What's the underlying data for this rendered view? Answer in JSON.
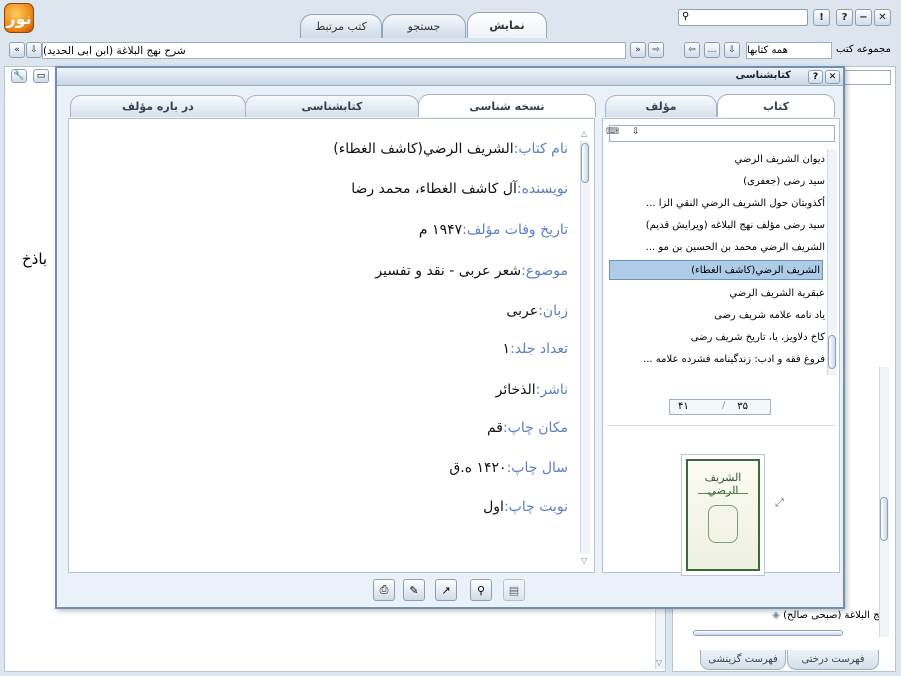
{
  "app": {
    "logo_text": "نور"
  },
  "top_tabs": [
    {
      "label": "نمایش",
      "active": true
    },
    {
      "label": "جستجو",
      "active": false
    },
    {
      "label": "کتب مرتبط",
      "active": false
    }
  ],
  "window_buttons": {
    "close": "✕",
    "minimize": "−",
    "help": "?",
    "info": "!"
  },
  "path": {
    "text": "شرح نهج البلاغة (ابن ابی الحدید)"
  },
  "collection": {
    "label": "مجموعه کتب",
    "value": "همه کتابها"
  },
  "background": {
    "book_word": "باذخ"
  },
  "right_tree": {
    "visible_item": "نهج البلاغة (صبحی صالح)",
    "bottom_tabs": [
      "فهرست درختی",
      "فهرست گزینشی"
    ]
  },
  "dialog": {
    "title": "کتابشناسی",
    "left_tabs": [
      {
        "label": "نسخه شناسی",
        "active": true
      },
      {
        "label": "کتابشناسی",
        "active": false
      },
      {
        "label": "در باره مؤلف",
        "active": false
      }
    ],
    "right_tabs": [
      {
        "label": "کتاب",
        "active": true
      },
      {
        "label": "مؤلف",
        "active": false
      }
    ],
    "info": [
      {
        "label": "نام کتاب:",
        "value": "الشريف الرضي(كاشف الغطاء)"
      },
      {
        "label": "نویسنده:",
        "value": "آل كاشف الغطاء، محمد رضا"
      },
      {
        "label": "تاریخ وفات مؤلف:",
        "value": "۱۹۴۷ م"
      },
      {
        "label": "موضوع:",
        "value": "شعر عربی - نقد و تفسیر"
      },
      {
        "label": "زبان:",
        "value": "عربی"
      },
      {
        "label": "تعداد جلد:",
        "value": "۱"
      },
      {
        "label": "ناشر:",
        "value": "الذخائر"
      },
      {
        "label": "مکان چاپ:",
        "value": "قم"
      },
      {
        "label": "سال چاپ:",
        "value": "۱۴۲۰ ه.ق"
      },
      {
        "label": "نوبت چاپ:",
        "value": "اول"
      }
    ],
    "books": [
      "ديوان الشريف الرضي",
      "سید رضی (جعفری)",
      "أكذوبتان حول الشريف الرضي النقي الزا ...",
      "سید رضی مؤلف نهج البلاغه (ویرایش قدیم)",
      "الشريف الرضي محمد بن الحسين بن مو ...",
      "الشريف الرضي(كاشف الغطاء)",
      "عبقرية الشريف الرضي",
      "یاد نامه علامه شریف رضی",
      "کاخ دلاویز، یا، تاریخ شریف رضی",
      "فروغ فقه و ادب: زندگینامه فشرده علامه ..."
    ],
    "selected_book_index": 5,
    "pager": {
      "current": "۳۵",
      "total": "۴۱"
    },
    "cover_title": "الشريف الرضي"
  }
}
